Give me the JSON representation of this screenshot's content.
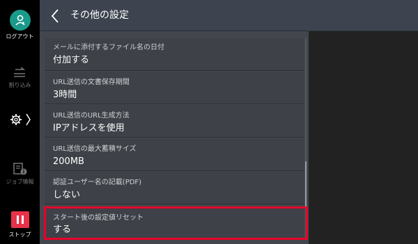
{
  "header": {
    "title": "その他の設定"
  },
  "rail": {
    "logout_label": "ログアウト",
    "interrupt_label": "割り込み",
    "jobinfo_label": "ジョブ情報",
    "stop_label": "ストップ"
  },
  "settings": [
    {
      "label": "メールに添付するファイル名の日付",
      "value": "付加する"
    },
    {
      "label": "URL送信の文書保存期間",
      "value": "3時間"
    },
    {
      "label": "URL送信のURL生成方法",
      "value": "IPアドレスを使用"
    },
    {
      "label": "URL送信の最大蓄積サイズ",
      "value": "200MB"
    },
    {
      "label": "認証ユーザー名の記載(PDF)",
      "value": "しない"
    },
    {
      "label": "スタート後の設定値リセット",
      "value": "する"
    }
  ],
  "colors": {
    "accent": "#1a9a8a",
    "stop": "#e8324a",
    "highlight": "#e8002a"
  }
}
